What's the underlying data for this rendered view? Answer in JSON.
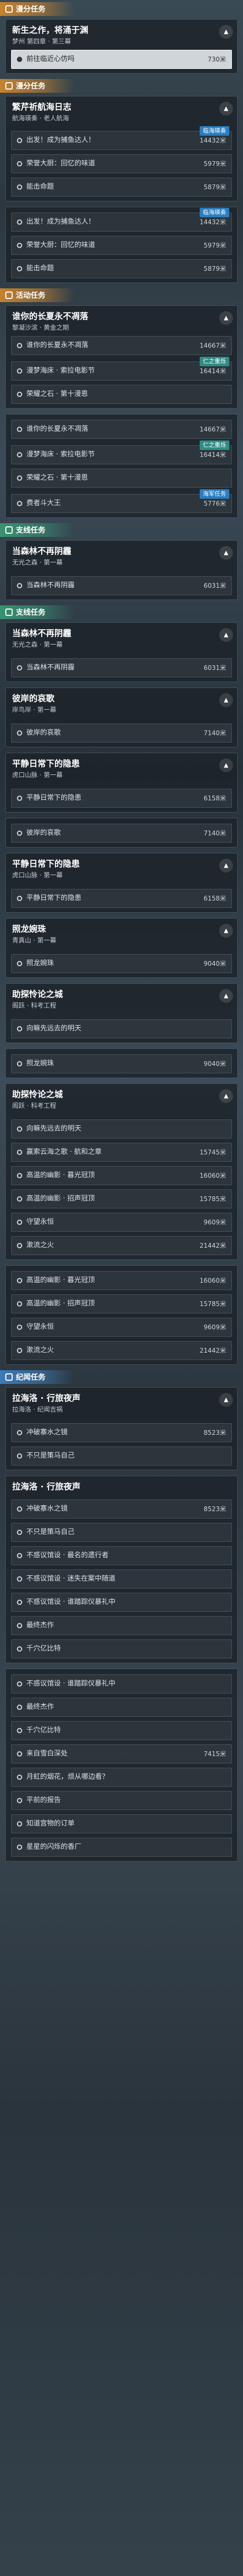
{
  "sections": {
    "main": "漫分任务",
    "daily1": "漫分任务",
    "event": "活动任务",
    "side1": "支线任务",
    "side2": "支线任务",
    "legend": "纪闻任务"
  },
  "cards": {
    "c1": {
      "title": "新生之作，将涌于渊",
      "sub": "梦州 第四章 · 第三幕",
      "rows": [
        {
          "label": "前往临近心仿吗",
          "dist": "730米"
        }
      ]
    },
    "c2": {
      "title": "繁芹祈航海日志",
      "sub": "航海瑛奏 · 老人航海",
      "rows": [
        {
          "label": "出发！成为捕鱼达人！",
          "dist": "14432米",
          "chip": "临海瑛奏"
        },
        {
          "label": "荣誉大厨：回忆的味道",
          "dist": "5979米"
        },
        {
          "label": "能击命题",
          "dist": "5879米"
        }
      ]
    },
    "c3": {
      "rows": [
        {
          "label": "出发！成为捕鱼达人！",
          "dist": "14432米",
          "chip": "临海瑛奏"
        },
        {
          "label": "荣誉大厨：回忆的味道",
          "dist": "5979米"
        },
        {
          "label": "能击命题",
          "dist": "5879米"
        }
      ]
    },
    "c4": {
      "title": "谁你的长夏永不凋落",
      "sub": "黎凝沙滨 · 黄金之期",
      "rows": [
        {
          "label": "谁你的长夏永不凋落",
          "dist": "14667米"
        },
        {
          "label": "漫梦海床 · 索拉电影节",
          "dist": "16414米",
          "chip": "仁之重烁"
        },
        {
          "label": "荣耀之石 · 第十漫恩",
          "dist": ""
        }
      ]
    },
    "c5": {
      "rows": [
        {
          "label": "谁你的长夏永不凋落",
          "dist": "14667米"
        },
        {
          "label": "漫梦海床 · 索拉电影节",
          "dist": "16414米",
          "chip": "仁之重烁"
        },
        {
          "label": "荣耀之石 · 第十漫恩",
          "dist": ""
        },
        {
          "label": "费者斗大王",
          "dist": "5776米",
          "chip": "海军任务"
        }
      ]
    },
    "c6": {
      "title": "当森林不再阴霾",
      "sub": "无光之森 · 第一幕",
      "rows": [
        {
          "label": "当森林不再阴霾",
          "dist": "6031米"
        }
      ]
    },
    "c7": {
      "title": "当森林不再阴霾",
      "sub": "无光之森 · 第一幕",
      "rows": [
        {
          "label": "当森林不再阴霾",
          "dist": "6031米"
        }
      ]
    },
    "c8": {
      "title": "彼岸的哀歌",
      "sub": "岸鸟岸 · 第一幕",
      "rows": [
        {
          "label": "彼岸的哀歌",
          "dist": "7140米"
        }
      ]
    },
    "c9": {
      "title": "平静日常下的隐患",
      "sub": "虎口山脉 · 第一幕",
      "rows": [
        {
          "label": "平静日常下的隐患",
          "dist": "6158米"
        }
      ]
    },
    "c10": {
      "rows": [
        {
          "label": "彼岸的哀歌",
          "dist": "7140米"
        }
      ]
    },
    "c11": {
      "title": "平静日常下的隐患",
      "sub": "虎口山脉 · 第一幕",
      "rows": [
        {
          "label": "平静日常下的隐患",
          "dist": "6158米"
        }
      ]
    },
    "c12": {
      "title": "照龙婉珠",
      "sub": "青真山 · 第一幕",
      "rows": [
        {
          "label": "照龙婉珠",
          "dist": "9040米"
        }
      ]
    },
    "c13": {
      "title": "助探怜论之城",
      "sub": "阁跃 · 科考工程",
      "rows": [
        {
          "label": "向嘛先远去的明天",
          "dist": ""
        }
      ]
    },
    "c14": {
      "rows": [
        {
          "label": "照龙婉珠",
          "dist": "9040米"
        }
      ]
    },
    "c15": {
      "title": "助探怜论之城",
      "sub": "阁跃 · 科考工程",
      "rows": [
        {
          "label": "向嘛先远去的明天",
          "dist": ""
        },
        {
          "label": "赢索云海之歌 · 航和之章",
          "dist": "15745米"
        },
        {
          "label": "高温的幽影 · 暮光冠顶",
          "dist": "16060米"
        },
        {
          "label": "高温的幽影 · 招声冠顶",
          "dist": "15785米"
        },
        {
          "label": "守望永恒",
          "dist": "9609米"
        },
        {
          "label": "漱流之火",
          "dist": "21442米"
        }
      ]
    },
    "c16": {
      "rows": [
        {
          "label": "高温的幽影 · 暮光冠顶",
          "dist": "16060米"
        },
        {
          "label": "高温的幽影 · 招声冠顶",
          "dist": "15785米"
        },
        {
          "label": "守望永恒",
          "dist": "9609米"
        },
        {
          "label": "漱流之火",
          "dist": "21442米"
        }
      ]
    },
    "c17": {
      "title": "拉海洛 · 行旅夜声",
      "sub": "拉海洛 · 纪闻吉祸",
      "rows": [
        {
          "label": "冲破寨水之镜",
          "dist": "8523米"
        },
        {
          "label": "不只是策马自己",
          "dist": ""
        }
      ]
    },
    "c18": {
      "title": "拉海洛 · 行旅夜声",
      "sub": "",
      "rows": [
        {
          "label": "冲破寨水之镜",
          "dist": "8523米"
        },
        {
          "label": "不只是策马自己",
          "dist": ""
        },
        {
          "label": "不惑议馆设 · 最名的遗行者",
          "dist": ""
        },
        {
          "label": "不惑议馆设 · 迷失在案中随道",
          "dist": ""
        },
        {
          "label": "不惑议馆设 · 谁踏踪仪暴礼中",
          "dist": ""
        },
        {
          "label": "最终杰作",
          "dist": ""
        },
        {
          "label": "千穴亿比特",
          "dist": ""
        }
      ]
    },
    "c19": {
      "rows": [
        {
          "label": "不惑议馆设 · 谁踏踪仪暴礼中",
          "dist": ""
        },
        {
          "label": "最终杰作",
          "dist": ""
        },
        {
          "label": "千穴亿比特",
          "dist": ""
        },
        {
          "label": "来自雪白深处",
          "dist": "7415米"
        },
        {
          "label": "月虹的烟花，烦从哪边看？",
          "dist": ""
        },
        {
          "label": "平前的报告",
          "dist": ""
        },
        {
          "label": "知道宫物的订单",
          "dist": ""
        },
        {
          "label": "星星的闪烁的香厂",
          "dist": ""
        }
      ]
    }
  }
}
